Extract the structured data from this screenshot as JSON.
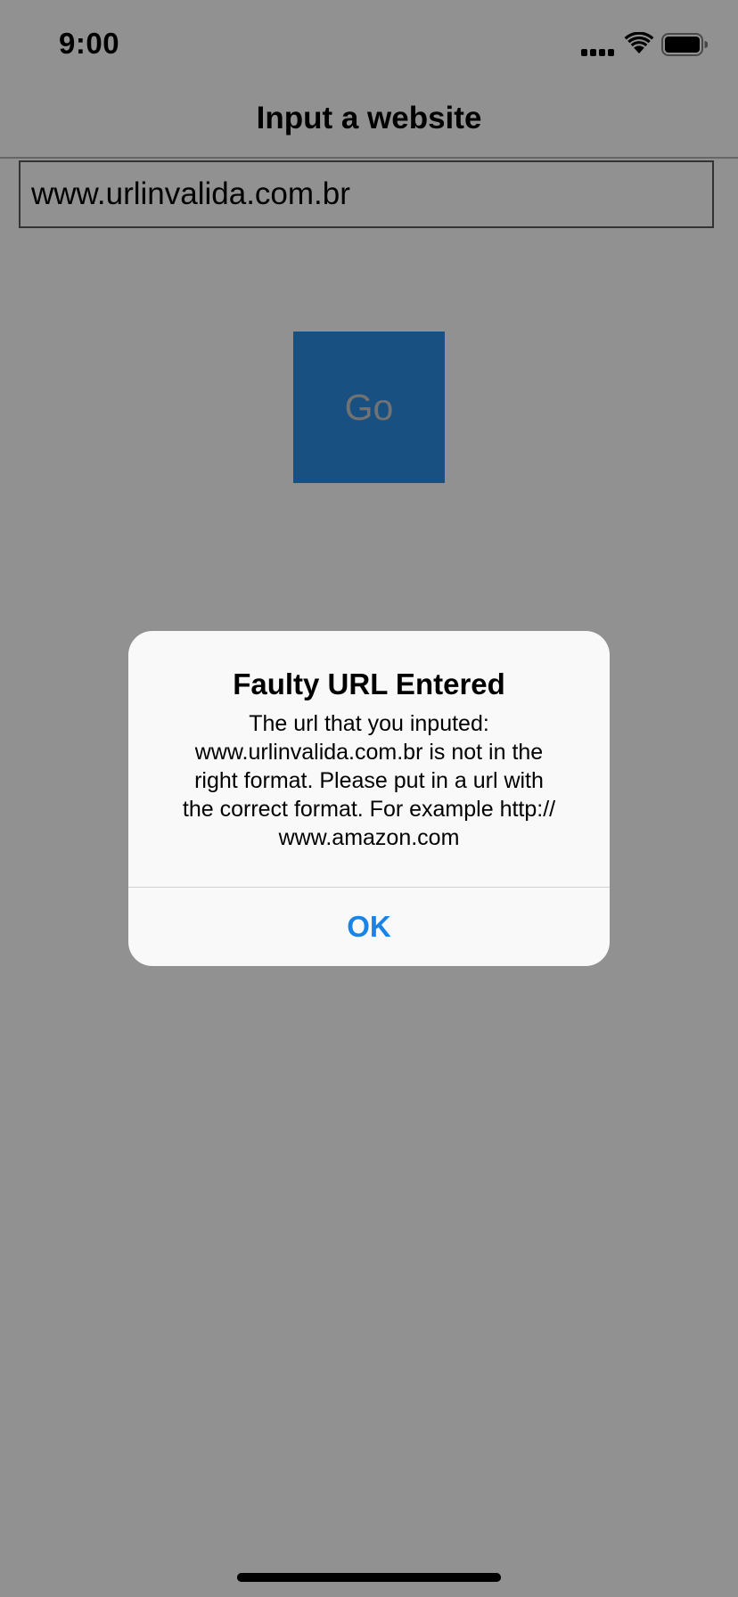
{
  "status_bar": {
    "time": "9:00"
  },
  "nav": {
    "title": "Input a website"
  },
  "url_input": {
    "value": "www.urlinvalida.com.br"
  },
  "go_button": {
    "label": "Go"
  },
  "alert": {
    "title": "Faulty URL Entered",
    "message": "The url that you inputed:\nwww.urlinvalida.com.br is not in the\nright format. Please put in a url with\nthe correct format. For example http://\nwww.amazon.com",
    "ok_label": "OK"
  },
  "icons": {
    "signal": "cellular-signal-icon",
    "wifi": "wifi-icon",
    "battery": "battery-icon"
  },
  "colors": {
    "go_button": "#2d8ee5",
    "alert_action": "#1a83e8",
    "dim_overlay": "rgba(0,0,0,0.43)"
  }
}
